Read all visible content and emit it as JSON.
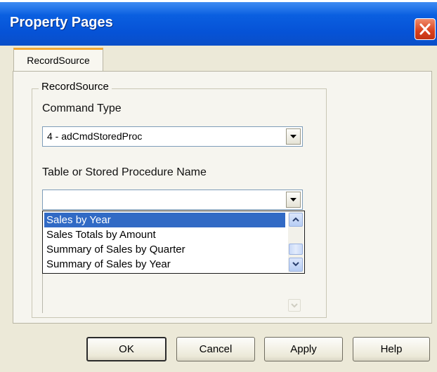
{
  "window": {
    "title": "Property Pages"
  },
  "tabs": [
    {
      "label": "RecordSource"
    }
  ],
  "group": {
    "title": "RecordSource",
    "command_type": {
      "label": "Command Type",
      "value": "4 - adCmdStoredProc"
    },
    "table_name": {
      "label": "Table or Stored Procedure Name",
      "value": "",
      "options": [
        "Sales by Year",
        "Sales Totals by Amount",
        "Summary of Sales by Quarter",
        "Summary of Sales by Year"
      ],
      "selected": "Sales by Year"
    }
  },
  "buttons": {
    "ok": "OK",
    "cancel": "Cancel",
    "apply": "Apply",
    "help": "Help"
  },
  "icons": {
    "close": "close-icon",
    "dropdown": "chevron-down-icon",
    "scroll_up": "scroll-up-icon",
    "scroll_down": "scroll-down-icon"
  },
  "colors": {
    "titlebar": "#0a5fe0",
    "selection": "#316ac5",
    "tab_highlight": "#f3a934"
  }
}
